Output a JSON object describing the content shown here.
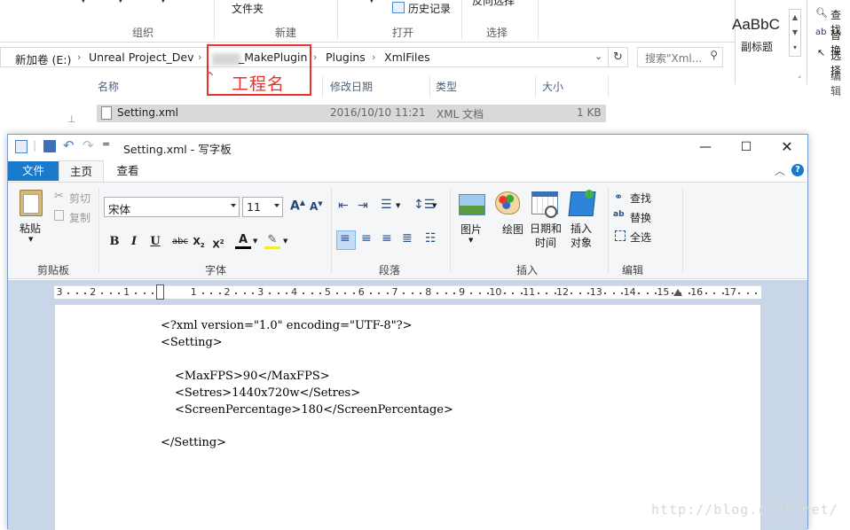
{
  "explorer": {
    "ribbon": {
      "items": {
        "folder": "文件夹",
        "history": "历史记录",
        "select_all_partial": "反向选择"
      },
      "groups": {
        "organize": "组织",
        "new": "新建",
        "open": "打开",
        "select": "选择"
      }
    },
    "address": {
      "crumbs": [
        "新加卷 (E:)",
        "Unreal Project_Dev",
        "_MakePlugin",
        "Plugins",
        "XmlFiles"
      ]
    },
    "search_placeholder": "搜索\"Xml...",
    "columns": {
      "name": "名称",
      "modified": "修改日期",
      "type": "类型",
      "size": "大小"
    },
    "file": {
      "name": "Setting.xml",
      "modified": "2016/10/10 11:21",
      "type": "XML 文档",
      "size": "1 KB"
    },
    "annotation": "工程名"
  },
  "word_bg": {
    "style_sample": "AaBbC",
    "style_name": "副标题",
    "find": "查找",
    "replace": "替换",
    "select": "选择",
    "group_edit": "编辑"
  },
  "wordpad": {
    "title": "Setting.xml - 写字板",
    "tabs": {
      "file": "文件",
      "home": "主页",
      "view": "查看"
    },
    "clipboard": {
      "paste": "粘贴",
      "cut": "剪切",
      "copy": "复制",
      "group": "剪贴板"
    },
    "font": {
      "name": "宋体",
      "size": "11",
      "group": "字体"
    },
    "paragraph": {
      "group": "段落"
    },
    "insert": {
      "picture": "图片",
      "paint": "绘图",
      "datetime": "日期和时间",
      "object": "插入对象",
      "group": "插入"
    },
    "editing": {
      "find": "查找",
      "replace": "替换",
      "select_all": "全选",
      "group": "编辑"
    },
    "ruler_numbers": [
      "3",
      "2",
      "1",
      "1",
      "2",
      "3",
      "4",
      "5",
      "6",
      "7",
      "8",
      "9",
      "10",
      "11",
      "12",
      "13",
      "14",
      "15",
      "16",
      "17"
    ],
    "document_lines": [
      "<?xml version=\"1.0\" encoding=\"UTF-8\"?>",
      "<Setting>",
      "",
      "    <MaxFPS>90</MaxFPS>",
      "    <Setres>1440x720w</Setres>",
      "    <ScreenPercentage>180</ScreenPercentage>",
      "",
      "</Setting>"
    ]
  },
  "watermark": "http://blog.csdn.net/"
}
